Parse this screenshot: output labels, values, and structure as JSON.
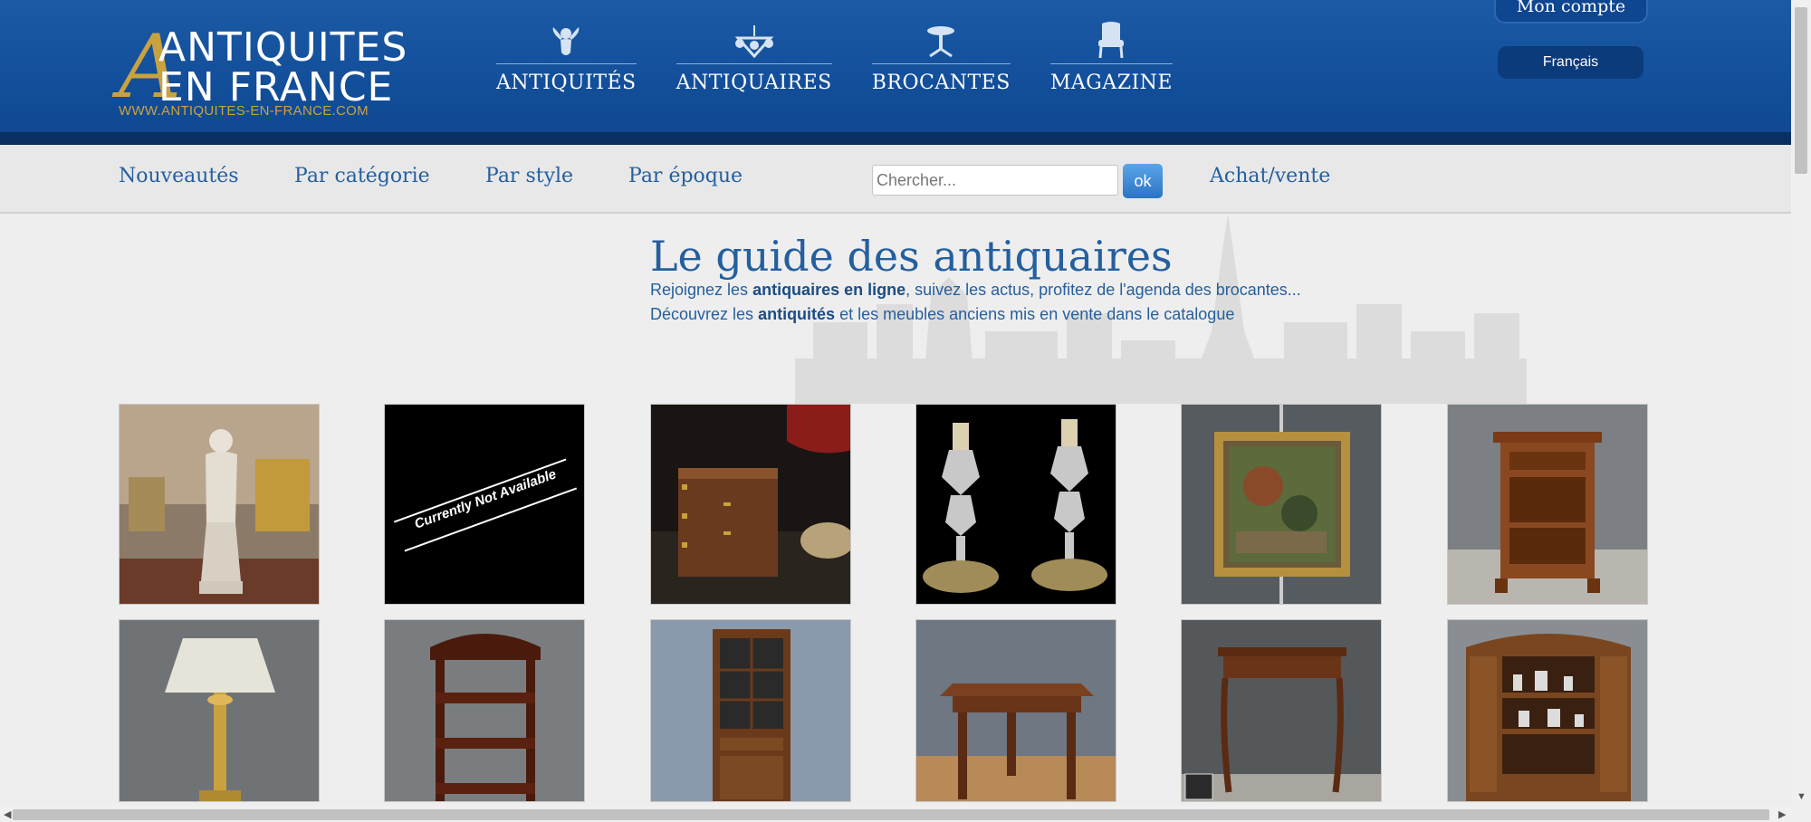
{
  "logo": {
    "line1": "ANTIQUITES",
    "line2": "EN FRANCE",
    "url": "WWW.ANTIQUITES-EN-FRANCE.COM",
    "letter": "A"
  },
  "main_nav": [
    {
      "label": "ANTIQUITÉS",
      "icon": "cherub-icon"
    },
    {
      "label": "ANTIQUAIRES",
      "icon": "chandelier-icon"
    },
    {
      "label": "BROCANTES",
      "icon": "gueridon-table-icon"
    },
    {
      "label": "MAGAZINE",
      "icon": "armchair-icon"
    }
  ],
  "account": {
    "label": "Mon compte"
  },
  "language": {
    "selected": "Français"
  },
  "sub_nav": {
    "items": [
      "Nouveautés",
      "Par catégorie",
      "Par style",
      "Par époque"
    ],
    "search_placeholder": "Chercher...",
    "search_button": "ok",
    "achat_vente": "Achat/vente"
  },
  "hero": {
    "title": "Le guide des antiquaires",
    "line1_pre": "Rejoignez les ",
    "line1_bold": "antiquaires en ligne",
    "line1_post": ", suivez les actus, profitez de l'agenda des brocantes...",
    "line2_pre": "Découvrez les ",
    "line2_bold": "antiquités",
    "line2_post": " et les meubles anciens mis en vente dans le catalogue"
  },
  "products": [
    {
      "name": "venus-statue"
    },
    {
      "name": "unavailable",
      "text": "Currently Not Available"
    },
    {
      "name": "wooden-box"
    },
    {
      "name": "crystal-candlesticks"
    },
    {
      "name": "framed-painting"
    },
    {
      "name": "bedside-cabinet"
    },
    {
      "name": "table-lamp"
    },
    {
      "name": "wall-shelf"
    },
    {
      "name": "glass-cabinet"
    },
    {
      "name": "square-table"
    },
    {
      "name": "console-table"
    },
    {
      "name": "carved-cabinet"
    }
  ],
  "colors": {
    "header": "#124e99",
    "gold": "#c9a23f",
    "link": "#245f9f"
  }
}
